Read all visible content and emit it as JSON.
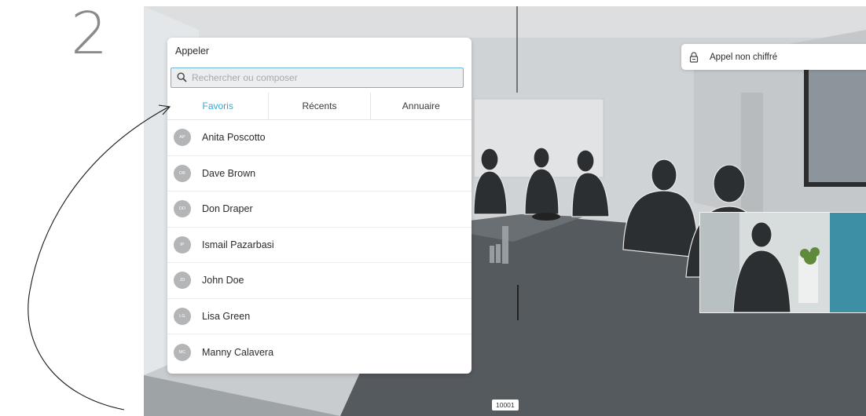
{
  "step": {
    "number": "2"
  },
  "panel": {
    "title": "Appeler",
    "search": {
      "placeholder": "Rechercher ou composer",
      "value": ""
    },
    "tabs": [
      {
        "label": "Favoris",
        "active": true
      },
      {
        "label": "Récents",
        "active": false
      },
      {
        "label": "Annuaire",
        "active": false
      }
    ],
    "contacts": [
      {
        "initials": "AP",
        "name": "Anita Poscotto"
      },
      {
        "initials": "DB",
        "name": "Dave Brown"
      },
      {
        "initials": "DD",
        "name": "Don Draper"
      },
      {
        "initials": "IP",
        "name": "Ismail Pazarbasi"
      },
      {
        "initials": "JD",
        "name": "John Doe"
      },
      {
        "initials": "LG",
        "name": "Lisa Green"
      },
      {
        "initials": "MC",
        "name": "Manny Calavera"
      }
    ]
  },
  "status": {
    "encryption_label": "Appel non chiffré"
  },
  "footer": {
    "call_id": "10001"
  },
  "colors": {
    "accent": "#2fa8d6",
    "search_border": "#6fb5d6",
    "avatar": "#b3b5b7"
  },
  "icons": {
    "search": "search-icon",
    "lock": "lock-icon"
  }
}
